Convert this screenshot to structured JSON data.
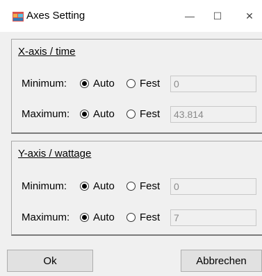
{
  "window": {
    "title": "Axes Setting",
    "icons": {
      "app": "app-icon",
      "minimize": "minimize-icon",
      "maximize": "maximize-icon",
      "close": "close-icon"
    },
    "glyphs": {
      "minimize": "—",
      "maximize": "☐",
      "close": "✕"
    }
  },
  "x_axis": {
    "title": "X-axis / time",
    "minimum": {
      "label": "Minimum:",
      "auto_label": "Auto",
      "fest_label": "Fest",
      "selected": "auto",
      "value": "0"
    },
    "maximum": {
      "label": "Maximum:",
      "auto_label": "Auto",
      "fest_label": "Fest",
      "selected": "auto",
      "value": "43.814"
    }
  },
  "y_axis": {
    "title": "Y-axis / wattage",
    "minimum": {
      "label": "Minimum:",
      "auto_label": "Auto",
      "fest_label": "Fest",
      "selected": "auto",
      "value": "0"
    },
    "maximum": {
      "label": "Maximum:",
      "auto_label": "Auto",
      "fest_label": "Fest",
      "selected": "auto",
      "value": "7"
    }
  },
  "buttons": {
    "ok": "Ok",
    "cancel": "Abbrechen"
  },
  "colors": {
    "window_bg": "#f0f0f0",
    "titlebar_bg": "#ffffff",
    "disabled_text": "#8a8a8a"
  }
}
